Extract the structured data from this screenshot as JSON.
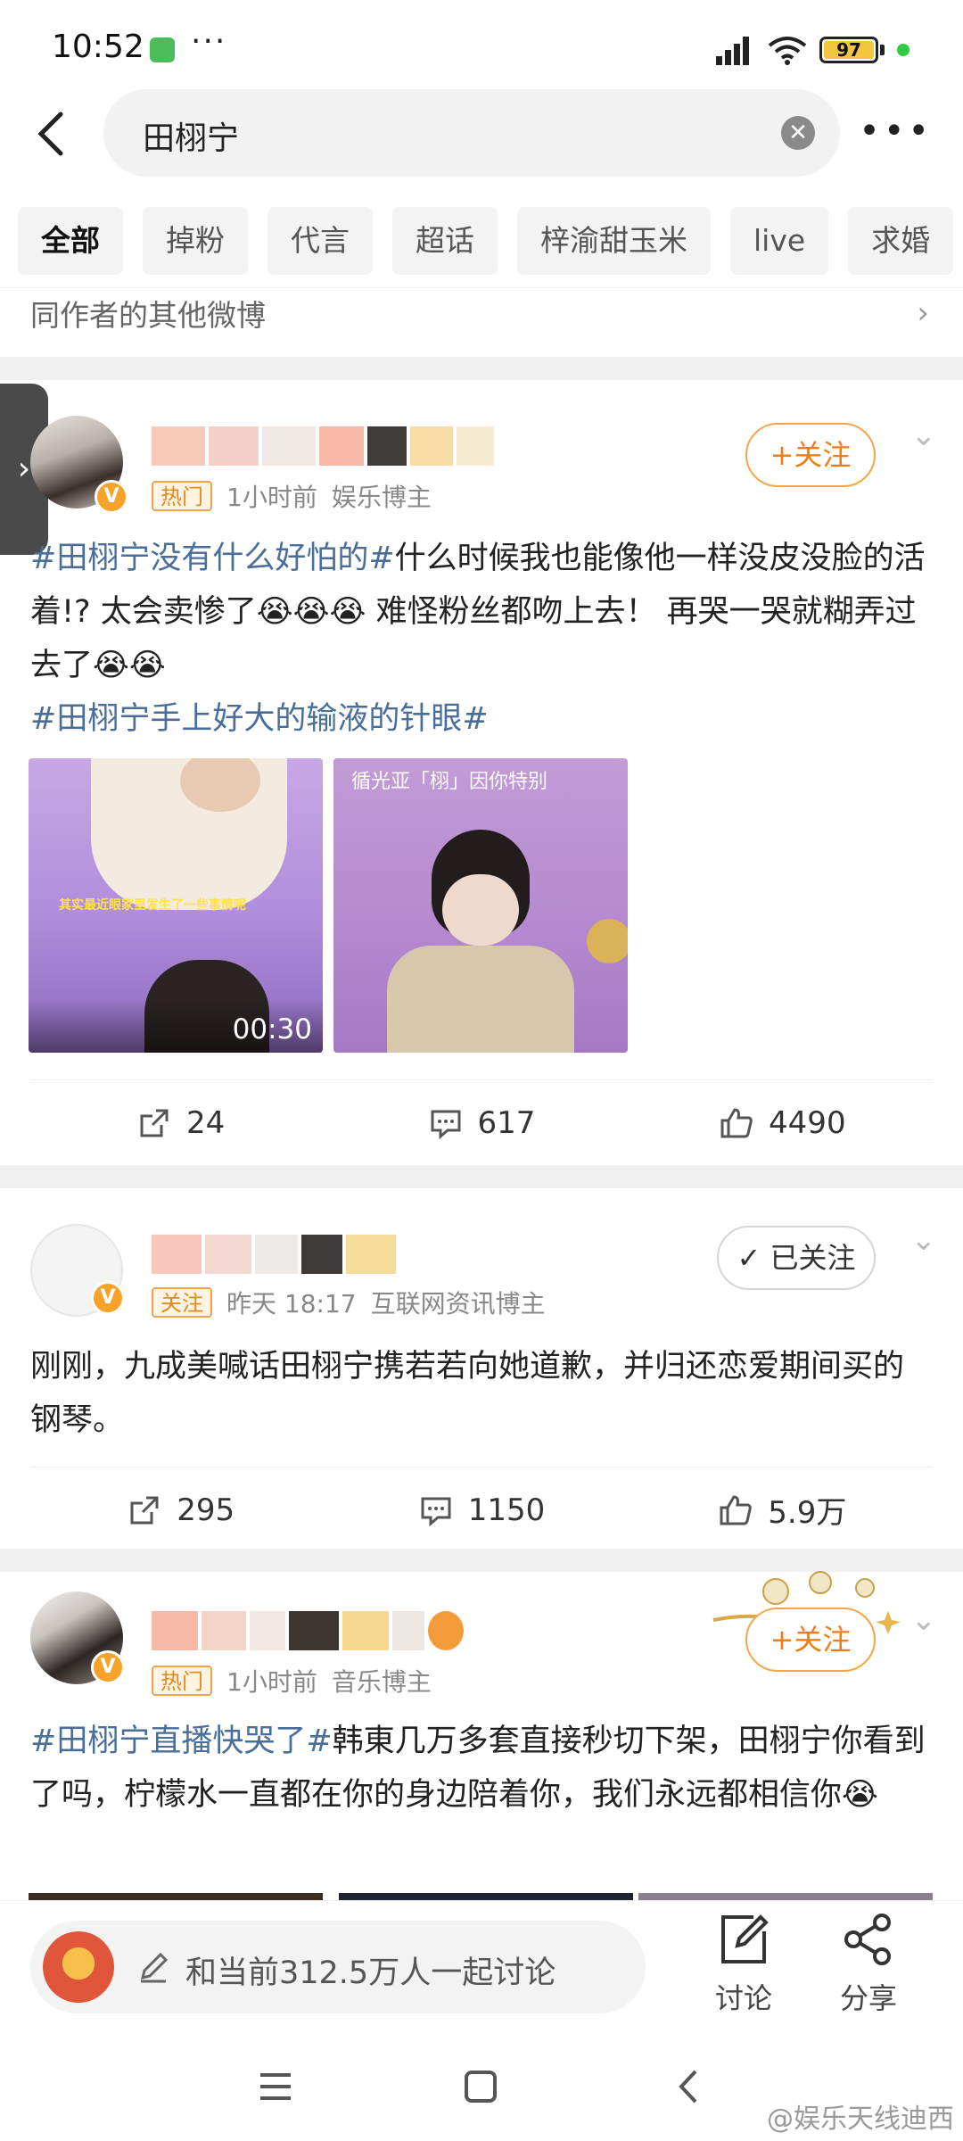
{
  "status_bar": {
    "time": "10:52",
    "dots": "···",
    "battery": "97",
    "network": "HD"
  },
  "search": {
    "query": "田栩宁",
    "clear_icon": "clear-icon",
    "more_icon": "more-icon"
  },
  "tabs": [
    "全部",
    "掉粉",
    "代言",
    "超话",
    "梓渝甜玉米",
    "live",
    "求婚"
  ],
  "other_row": {
    "label": "同作者的其他微博"
  },
  "posts": [
    {
      "tag": "热门",
      "time": "1小时前",
      "role": "娱乐博主",
      "follow": "+关注",
      "text": [
        {
          "t": "#田栩宁没有什么好怕的#",
          "topic": true
        },
        {
          "t": "什么时候我也能像他一样没皮没脸的活着!? 太会卖惨了😭😭😭 难怪粉丝都吻上去！ 再哭一哭就糊弄过去了😭😭",
          "topic": false
        }
      ],
      "topic2": "#田栩宁手上好大的输液的针眼#",
      "video_duration": "00:30",
      "thumb1_caption": "其实最近眼家里发生了一些事情呢",
      "thumb2_title": "循光亚「栩」因你特别",
      "repost": "24",
      "comment": "617",
      "like": "4490"
    },
    {
      "tag": "关注",
      "time": "昨天 18:17",
      "role": "互联网资讯博主",
      "follow": "已关注",
      "text": "刚刚，九成美喊话田栩宁携若若向她道歉，并归还恋爱期间买的钢琴。",
      "repost": "295",
      "comment": "1150",
      "like": "5.9万"
    },
    {
      "tag": "热门",
      "time": "1小时前",
      "role": "音乐博主",
      "follow": "+关注",
      "topic": "#田栩宁直播快哭了#",
      "text": "韩東几万多套直接秒切下架，田栩宁你看到了吗，柠檬水一直都在你的身边陪着你，我们永远都相信你😭"
    }
  ],
  "bottom": {
    "composer": "和当前312.5万人一起讨论",
    "discuss": "讨论",
    "share": "分享"
  },
  "watermark": "@娱乐天线迪西",
  "colors": {
    "accent": "#f07d14",
    "topic": "#4a6e9a",
    "badge": "#f7a32a"
  }
}
